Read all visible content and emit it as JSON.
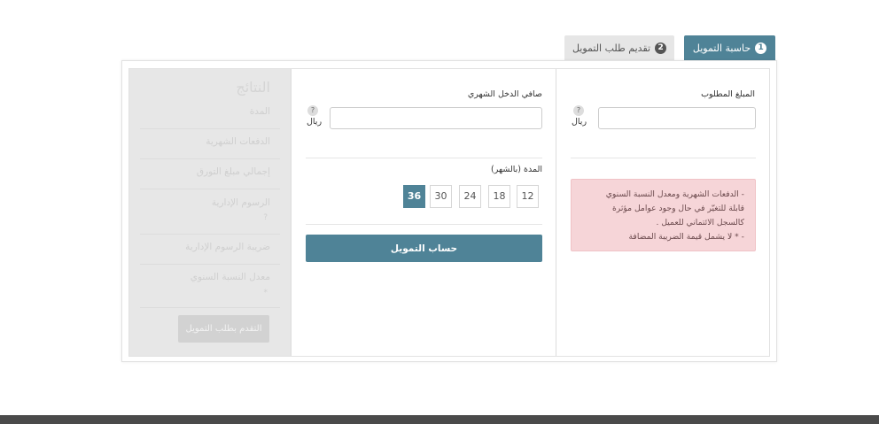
{
  "tabs": [
    {
      "num": "1",
      "label": "حاسبة التمويل"
    },
    {
      "num": "2",
      "label": "تقديم طلب التمويل"
    }
  ],
  "amount": {
    "label": "المبلغ المطلوب",
    "value": "",
    "help": "?",
    "unit": "ريال"
  },
  "income": {
    "label": "صافي الدخل الشهري",
    "value": "",
    "help": "?",
    "unit": "ريال"
  },
  "term": {
    "label": "المدة (بالشهر)",
    "options": [
      "12",
      "18",
      "24",
      "30",
      "36"
    ],
    "selected": "36"
  },
  "calculate_label": "حساب التمويل",
  "notice": {
    "line1": "- الدفعات الشهرية ومعدل النسبة السنوي",
    "line2": "قابلة للتغيّر في حال وجود عوامل مؤثرة",
    "line3": "كالسجل الائتماني للعميل .",
    "line4": "- * لا يشمل قيمة الضريبة المضافة"
  },
  "results": {
    "title": "النتائج",
    "rows": [
      {
        "label": "المدة"
      },
      {
        "label": "الدفعات الشهرية"
      },
      {
        "label": "إجمالي مبلغ التورق"
      },
      {
        "label": "الرسوم الإدارية",
        "note": "?"
      },
      {
        "label": "ضريبة الرسوم الإدارية"
      },
      {
        "label": "معدل النسبة السنوي",
        "note": "*"
      }
    ],
    "apply_label": "التقدم بطلب التمويل"
  },
  "colors": {
    "accent": "#4f8397",
    "alert_bg": "#f6d5d8",
    "results_bg": "#e7e7e7",
    "footer": "#4a4a4a"
  }
}
